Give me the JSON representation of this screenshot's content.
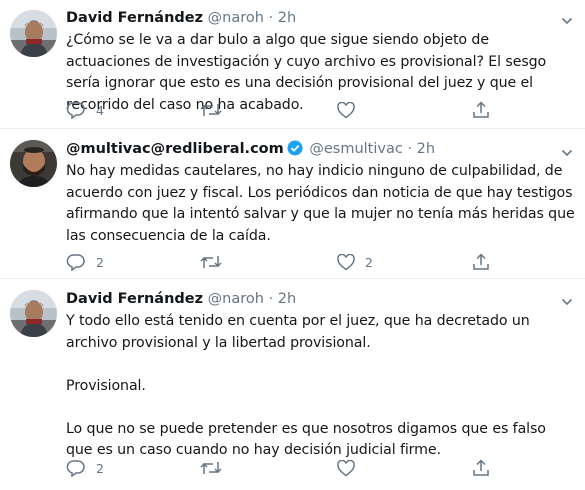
{
  "tweets": [
    {
      "name": "David Fernández",
      "handle": "@naroh",
      "separator": "·",
      "time": "2h",
      "text": "¿Cómo se le va a dar bulo a algo que sigue siendo objeto de actuaciones de investigación y cuyo archivo es provisional? El sesgo sería ignorar que esto es una decisión provisional del juez y que el recorrido del caso no ha acabado.",
      "reply_count": "4",
      "retweet_count": "",
      "like_count": ""
    },
    {
      "name": "@multivac@redliberal.com",
      "verified": true,
      "handle": "@esmultivac",
      "separator": "·",
      "time": "2h",
      "text": "No hay medidas cautelares, no hay indicio ninguno de culpabilidad, de acuerdo con juez y fiscal. Los periódicos dan noticia de que hay testigos afirmando que la intentó salvar y que la mujer no tenía más heridas que las consecuencia de la caída.",
      "reply_count": "2",
      "retweet_count": "",
      "like_count": "2"
    },
    {
      "name": "David Fernández",
      "handle": "@naroh",
      "separator": "·",
      "time": "2h",
      "text": "Y todo ello está tenido en cuenta por el juez, que ha decretado un archivo provisional y la libertad provisional.\n\nProvisional.\n\nLo que no se puede pretender es que nosotros digamos que es falso que es un caso cuando no hay decisión judicial firme.",
      "reply_count": "2",
      "retweet_count": "",
      "like_count": ""
    }
  ],
  "colors": {
    "text": "#14171a",
    "secondary": "#657786",
    "verified": "#1da1f2",
    "divider": "#e6ecf0"
  },
  "icons": [
    "reply-icon",
    "retweet-icon",
    "like-icon",
    "share-icon",
    "caret-down-icon",
    "verified-badge-icon"
  ]
}
